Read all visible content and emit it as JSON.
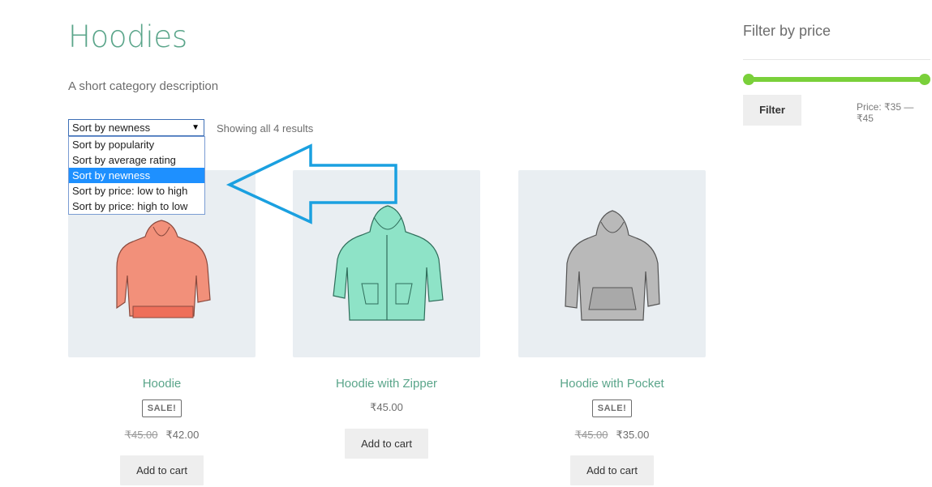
{
  "category": {
    "title": "Hoodies",
    "description": "A short category description"
  },
  "sorting": {
    "selected_label": "Sort by newness",
    "options": [
      {
        "label": "Sort by popularity"
      },
      {
        "label": "Sort by average rating"
      },
      {
        "label": "Sort by newness"
      },
      {
        "label": "Sort by price: low to high"
      },
      {
        "label": "Sort by price: high to low"
      }
    ],
    "selected_index": 2
  },
  "result_count": "Showing all 4 results",
  "products": [
    {
      "name": "Hoodie",
      "sale_badge": "SALE!",
      "old_price": "₹45.00",
      "price": "₹42.00",
      "button": "Add to cart",
      "color": "#f2907a"
    },
    {
      "name": "Hoodie with Zipper",
      "price": "₹45.00",
      "button": "Add to cart",
      "color": "#8ee3c7"
    },
    {
      "name": "Hoodie with Pocket",
      "sale_badge": "SALE!",
      "old_price": "₹45.00",
      "price": "₹35.00",
      "button": "Add to cart",
      "color": "#b9b9b9"
    }
  ],
  "sidebar": {
    "widget_title": "Filter by price",
    "filter_button": "Filter",
    "price_label": "Price: ₹35 — ₹45",
    "slider_color": "#7ad03a"
  },
  "colors": {
    "accent": "#5aa58a",
    "annotation_arrow": "#1aa0e0",
    "dropdown_highlight": "#1e90ff"
  },
  "icons": {
    "select_caret": "▼"
  }
}
